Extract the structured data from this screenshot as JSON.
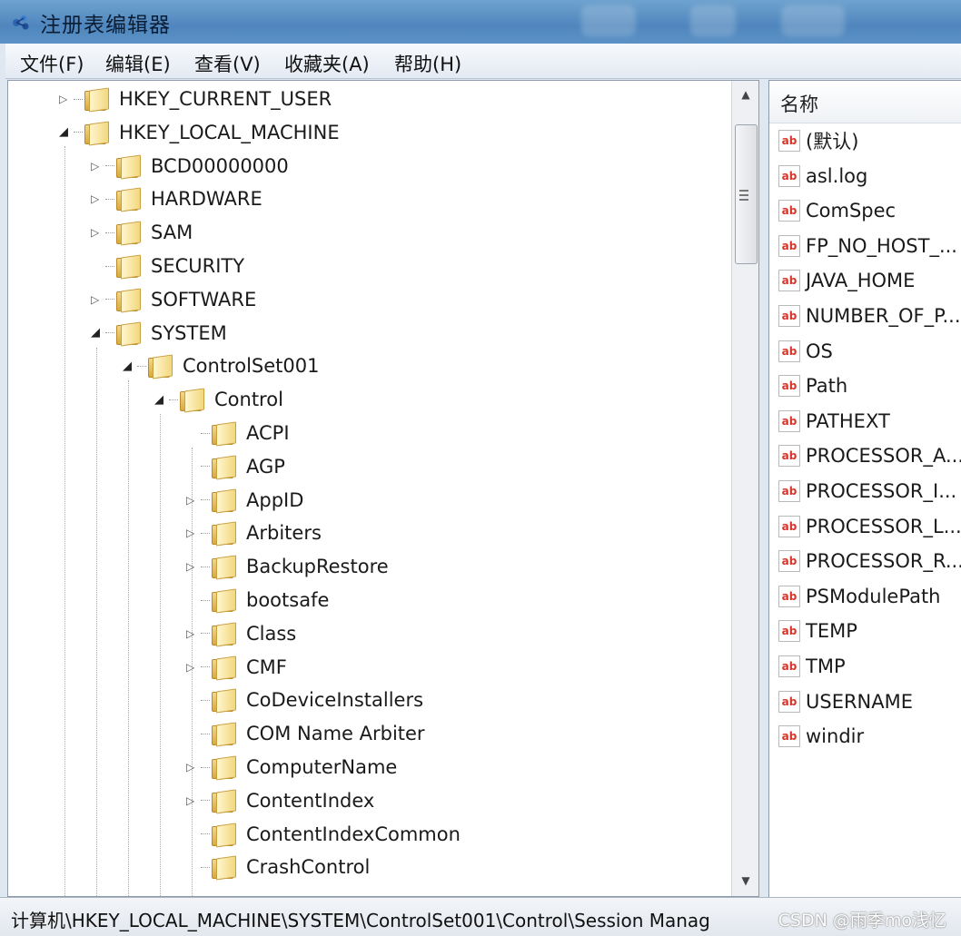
{
  "window": {
    "title": "注册表编辑器"
  },
  "menu": [
    "文件(F)",
    "编辑(E)",
    "查看(V)",
    "收藏夹(A)",
    "帮助(H)"
  ],
  "tree": [
    {
      "label": "HKEY_CURRENT_USER",
      "level": 1,
      "expander": "collapsed"
    },
    {
      "label": "HKEY_LOCAL_MACHINE",
      "level": 1,
      "expander": "expanded"
    },
    {
      "label": "BCD00000000",
      "level": 2,
      "expander": "collapsed"
    },
    {
      "label": "HARDWARE",
      "level": 2,
      "expander": "collapsed"
    },
    {
      "label": "SAM",
      "level": 2,
      "expander": "collapsed"
    },
    {
      "label": "SECURITY",
      "level": 2,
      "expander": "none"
    },
    {
      "label": "SOFTWARE",
      "level": 2,
      "expander": "collapsed"
    },
    {
      "label": "SYSTEM",
      "level": 2,
      "expander": "expanded"
    },
    {
      "label": "ControlSet001",
      "level": 3,
      "expander": "expanded"
    },
    {
      "label": "Control",
      "level": 4,
      "expander": "expanded"
    },
    {
      "label": "ACPI",
      "level": 5,
      "expander": "none"
    },
    {
      "label": "AGP",
      "level": 5,
      "expander": "none"
    },
    {
      "label": "AppID",
      "level": 5,
      "expander": "collapsed"
    },
    {
      "label": "Arbiters",
      "level": 5,
      "expander": "collapsed"
    },
    {
      "label": "BackupRestore",
      "level": 5,
      "expander": "collapsed"
    },
    {
      "label": "bootsafe",
      "level": 5,
      "expander": "none"
    },
    {
      "label": "Class",
      "level": 5,
      "expander": "collapsed"
    },
    {
      "label": "CMF",
      "level": 5,
      "expander": "collapsed"
    },
    {
      "label": "CoDeviceInstallers",
      "level": 5,
      "expander": "none"
    },
    {
      "label": "COM Name Arbiter",
      "level": 5,
      "expander": "none"
    },
    {
      "label": "ComputerName",
      "level": 5,
      "expander": "collapsed"
    },
    {
      "label": "ContentIndex",
      "level": 5,
      "expander": "collapsed"
    },
    {
      "label": "ContentIndexCommon",
      "level": 5,
      "expander": "none"
    },
    {
      "label": "CrashControl",
      "level": 5,
      "expander": "none"
    }
  ],
  "values_header": "名称",
  "values": [
    "(默认)",
    "asl.log",
    "ComSpec",
    "FP_NO_HOST_...",
    "JAVA_HOME",
    "NUMBER_OF_P...",
    "OS",
    "Path",
    "PATHEXT",
    "PROCESSOR_A...",
    "PROCESSOR_I...",
    "PROCESSOR_L...",
    "PROCESSOR_R...",
    "PSModulePath",
    "TEMP",
    "TMP",
    "USERNAME",
    "windir"
  ],
  "value_icon_text": "ab",
  "status_path": "计算机\\HKEY_LOCAL_MACHINE\\SYSTEM\\ControlSet001\\Control\\Session Manag",
  "watermark": "CSDN @雨季mo浅忆"
}
